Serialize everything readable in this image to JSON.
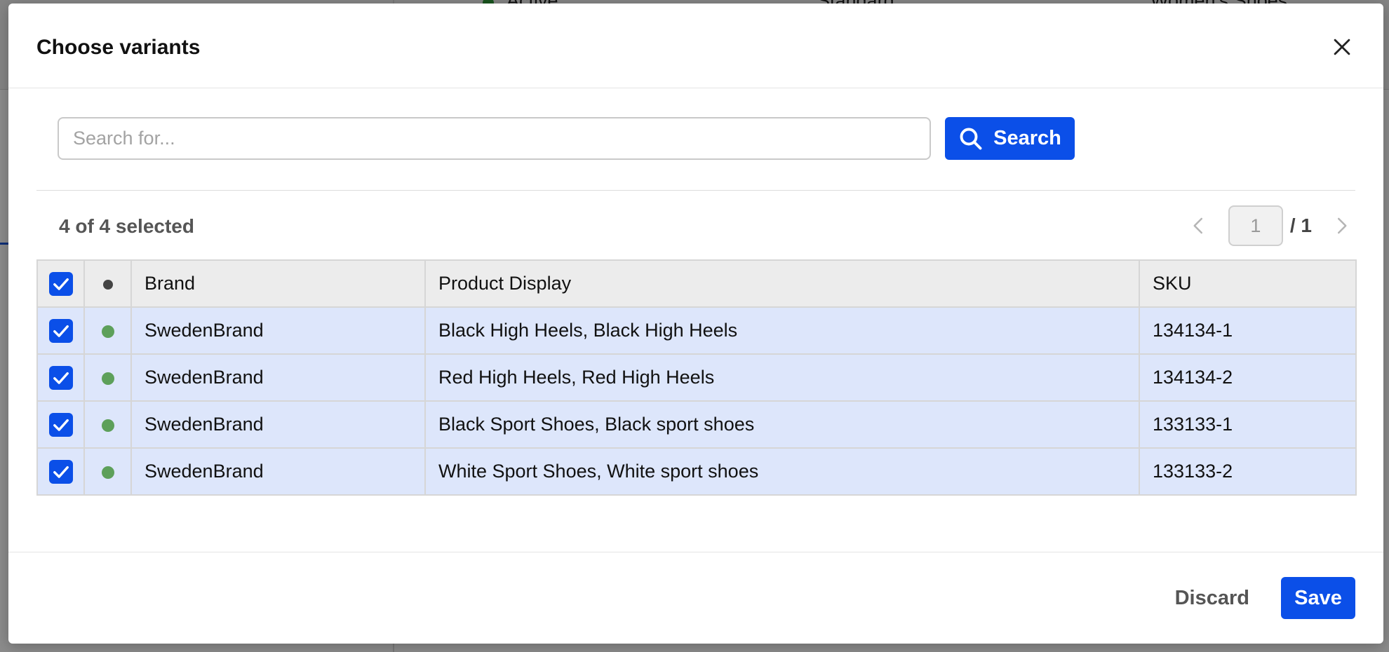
{
  "background": {
    "status_text": "Active",
    "type_text": "Standard",
    "category_text": "Women's Shoes"
  },
  "modal": {
    "title": "Choose variants",
    "search": {
      "placeholder": "Search for...",
      "value": "",
      "button_label": "Search"
    },
    "selection": {
      "summary": "4 of 4 selected"
    },
    "pagination": {
      "current_page": "1",
      "total_label": "/ 1"
    },
    "table": {
      "columns": [
        "",
        "",
        "Brand",
        "Product Display",
        "SKU"
      ],
      "header_status_dot_color": "#444444",
      "rows": [
        {
          "checked": true,
          "status_color": "#5da05a",
          "brand": "SwedenBrand",
          "product": "Black High Heels, Black High Heels",
          "sku": "134134-1"
        },
        {
          "checked": true,
          "status_color": "#5da05a",
          "brand": "SwedenBrand",
          "product": "Red High Heels, Red High Heels",
          "sku": "134134-2"
        },
        {
          "checked": true,
          "status_color": "#5da05a",
          "brand": "SwedenBrand",
          "product": "Black Sport Shoes, Black sport shoes",
          "sku": "133133-1"
        },
        {
          "checked": true,
          "status_color": "#5da05a",
          "brand": "SwedenBrand",
          "product": "White Sport Shoes, White sport shoes",
          "sku": "133133-2"
        }
      ]
    },
    "footer": {
      "discard_label": "Discard",
      "save_label": "Save"
    },
    "colors": {
      "primary": "#0b4fe8",
      "row_selected_bg": "#dde6fb",
      "link": "#1a4fd0"
    }
  }
}
